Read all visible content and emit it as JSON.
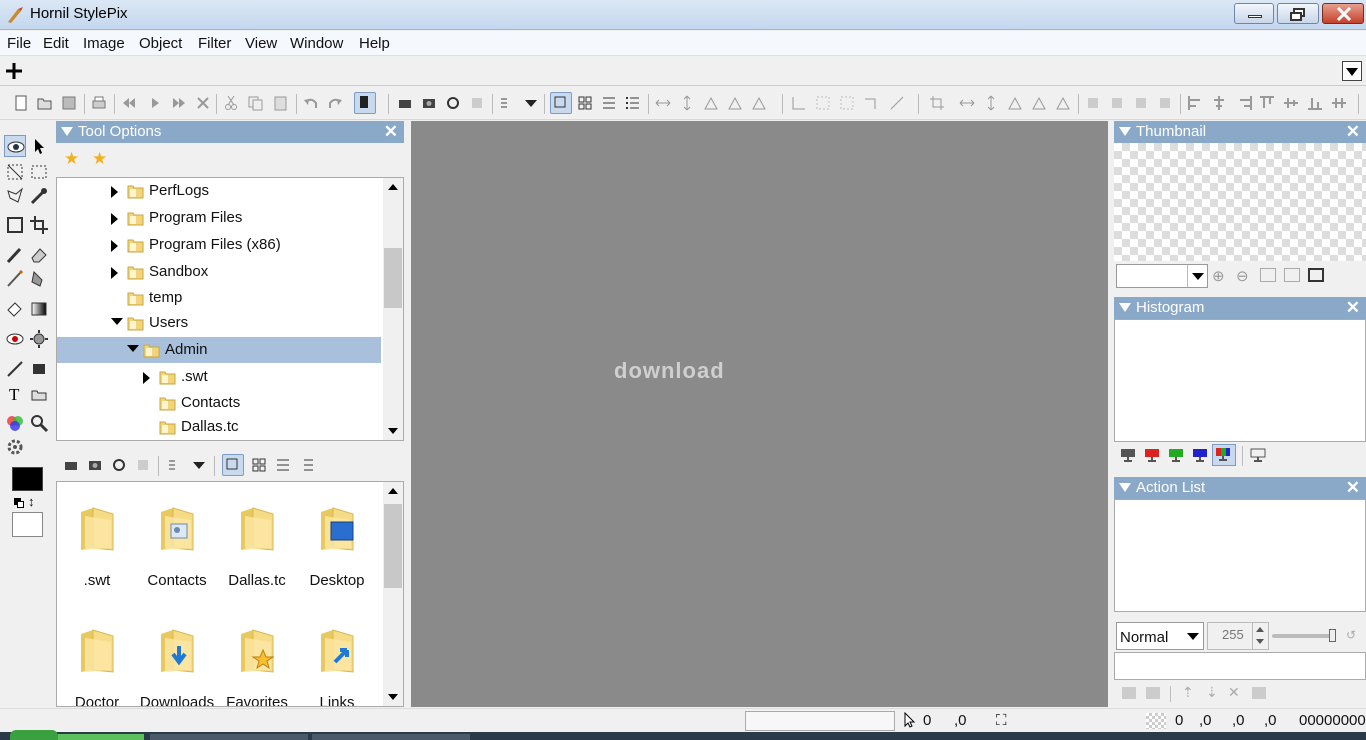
{
  "window": {
    "title": "Hornil StylePix"
  },
  "menu": [
    "File",
    "Edit",
    "Image",
    "Object",
    "Filter",
    "View",
    "Window",
    "Help"
  ],
  "tool_options": {
    "title": "Tool Options"
  },
  "tree": [
    {
      "label": "PerfLogs",
      "state": "collapsed"
    },
    {
      "label": "Program Files",
      "state": "collapsed"
    },
    {
      "label": "Program Files (x86)",
      "state": "collapsed"
    },
    {
      "label": "Sandbox",
      "state": "collapsed"
    },
    {
      "label": "temp",
      "state": "leaf"
    },
    {
      "label": "Users",
      "state": "expanded"
    },
    {
      "label": "Admin",
      "state": "expanded",
      "selected": true
    },
    {
      "label": ".swt",
      "state": "collapsed"
    },
    {
      "label": "Contacts",
      "state": "leaf"
    },
    {
      "label": "Dallas.tc",
      "state": "leaf"
    }
  ],
  "browser_items": [
    {
      "label": ".swt",
      "icon": "folder"
    },
    {
      "label": "Contacts",
      "icon": "contacts-folder"
    },
    {
      "label": "Dallas.tc",
      "icon": "folder"
    },
    {
      "label": "Desktop",
      "icon": "desktop-folder"
    },
    {
      "label": "Doctor",
      "icon": "folder"
    },
    {
      "label": "Downloads",
      "icon": "downloads-folder"
    },
    {
      "label": "Favorites",
      "icon": "favorites-folder"
    },
    {
      "label": "Links",
      "icon": "links-folder"
    }
  ],
  "canvas": {
    "watermark": "download"
  },
  "panels": {
    "thumbnail": {
      "title": "Thumbnail"
    },
    "histogram": {
      "title": "Histogram"
    },
    "action_list": {
      "title": "Action List"
    }
  },
  "layer": {
    "blend_mode": "Normal",
    "opacity": "255"
  },
  "status": {
    "x": "0",
    "y": ",0",
    "sel": "0",
    "sel_y": ",0",
    "sel_w": ",0",
    "sel_h": ",0",
    "color": "00000000"
  },
  "colors": {
    "accent": "#8aa8c8",
    "selection": "#a9c0dc",
    "canvas": "#8a8a8a"
  }
}
